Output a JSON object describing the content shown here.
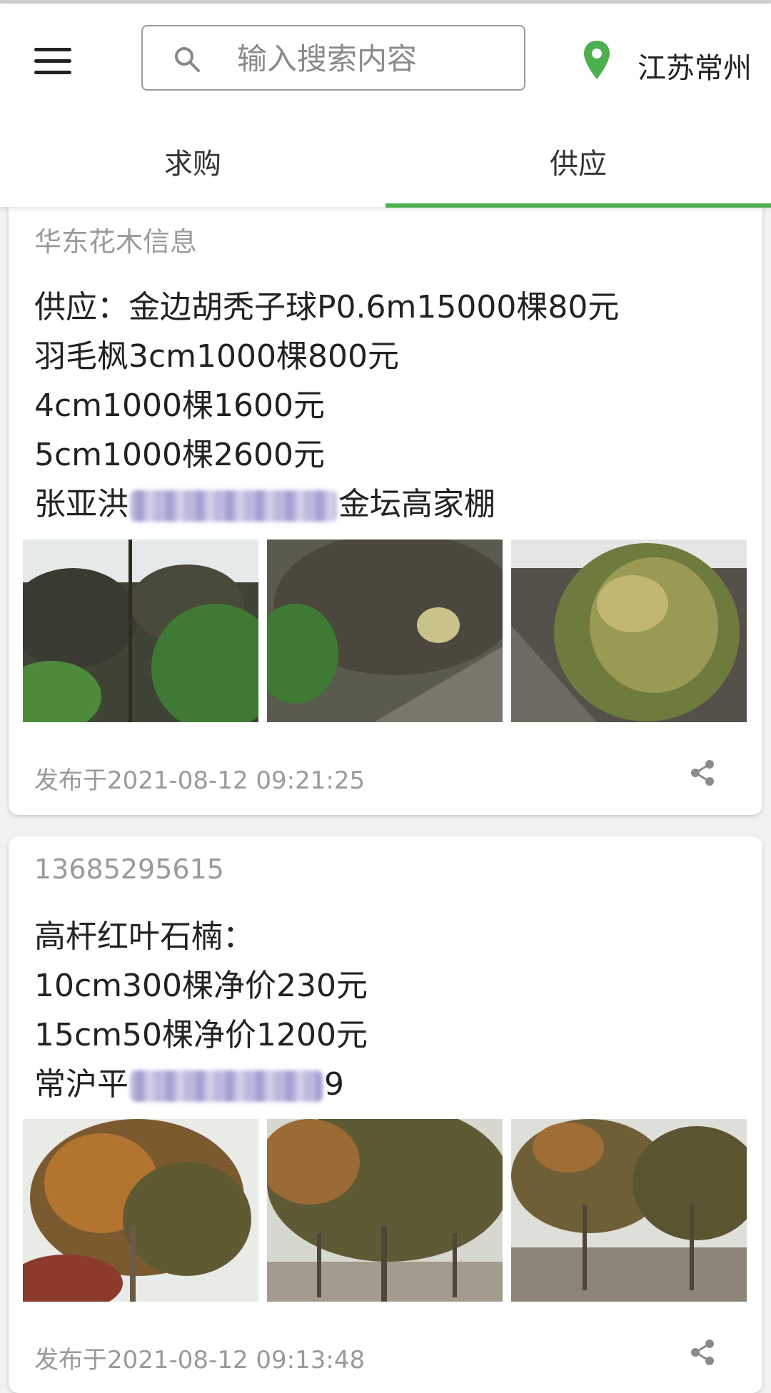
{
  "header": {
    "search_placeholder": "输入搜索内容",
    "location": "江苏常州",
    "tabs": [
      "求购",
      "供应"
    ],
    "active_tab": "供应"
  },
  "colors": {
    "accent": "#4caf50"
  },
  "posts": [
    {
      "author": "华东花木信息",
      "lines": [
        "供应：金边胡秃子球P0.6m15000棵80元",
        "羽毛枫3cm1000棵800元",
        "4cm1000棵1600元",
        "5cm1000棵2600元"
      ],
      "contact_prefix": "张亚洪",
      "contact_suffix": "金坛高家棚",
      "photo_count": 3,
      "time": "发布于2021-08-12 09:21:25"
    },
    {
      "author": "13685295615",
      "lines": [
        "高杆红叶石楠：",
        "10cm300棵净价230元",
        "15cm50棵净价1200元"
      ],
      "contact_prefix": "常沪平",
      "contact_suffix": "9",
      "photo_count": 3,
      "time": "发布于2021-08-12 09:13:48"
    }
  ],
  "icons": [
    "menu-icon",
    "search-icon",
    "location-pin-icon",
    "share-icon"
  ]
}
